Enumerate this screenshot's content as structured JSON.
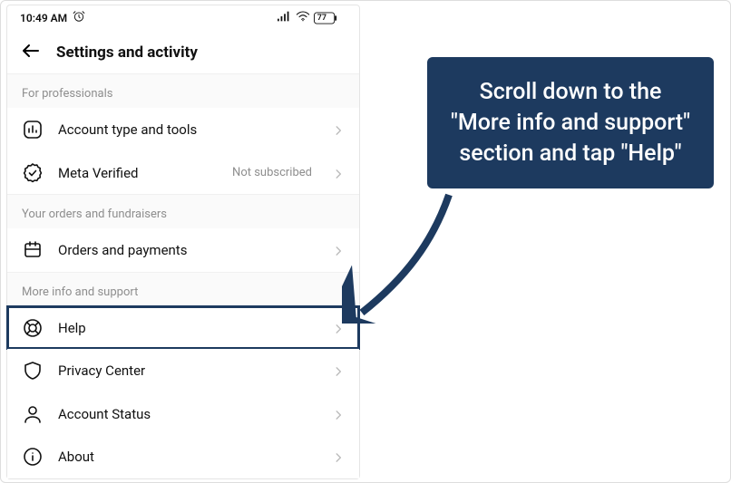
{
  "statusbar": {
    "time": "10:49 AM",
    "battery_label": "77"
  },
  "header": {
    "title": "Settings and activity"
  },
  "sections": {
    "professionals": {
      "label": "For professionals",
      "account_tools": "Account type and tools",
      "meta_verified": "Meta Verified",
      "meta_verified_status": "Not subscribed"
    },
    "orders": {
      "label": "Your orders and fundraisers",
      "orders_payments": "Orders and payments"
    },
    "support": {
      "label": "More info and support",
      "help": "Help",
      "privacy_center": "Privacy Center",
      "account_status": "Account Status",
      "about": "About"
    }
  },
  "callout": {
    "text": "Scroll down to the \"More info and support\" section and tap \"Help\""
  },
  "colors": {
    "accent": "#1d3a5f"
  }
}
